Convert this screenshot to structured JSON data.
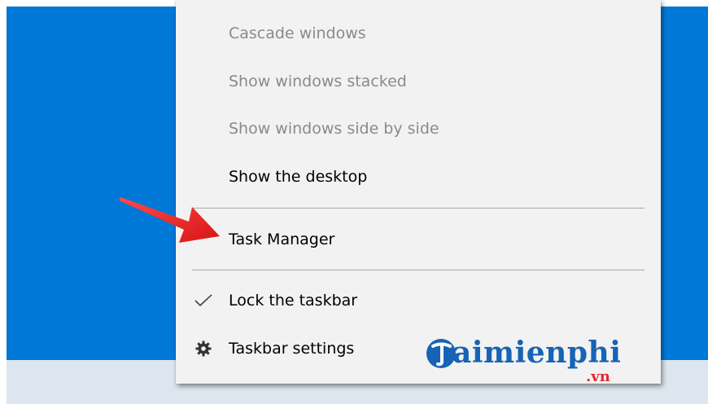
{
  "menu": {
    "items": [
      {
        "label": "Cascade windows",
        "enabled": false
      },
      {
        "label": "Show windows stacked",
        "enabled": false
      },
      {
        "label": "Show windows side by side",
        "enabled": false
      },
      {
        "label": "Show the desktop",
        "enabled": true
      },
      {
        "label": "Task Manager",
        "enabled": true
      },
      {
        "label": "Lock the taskbar",
        "enabled": true,
        "checked": true,
        "icon": "checkmark-icon"
      },
      {
        "label": "Taskbar settings",
        "enabled": true,
        "icon": "gear-icon"
      }
    ]
  },
  "annotation": {
    "icon": "red-arrow-pointer",
    "color": "#e8262d",
    "points_to": "Task Manager"
  },
  "watermark": {
    "brand": "aimienphi",
    "tld": ".vn",
    "brand_color": "#1763b5",
    "tld_color": "#e8262d"
  },
  "colors": {
    "desktop": "#0078d7",
    "taskbar": "#dde6ee",
    "menu_bg": "#f2f2f2",
    "disabled_text": "#8a8a8a"
  }
}
